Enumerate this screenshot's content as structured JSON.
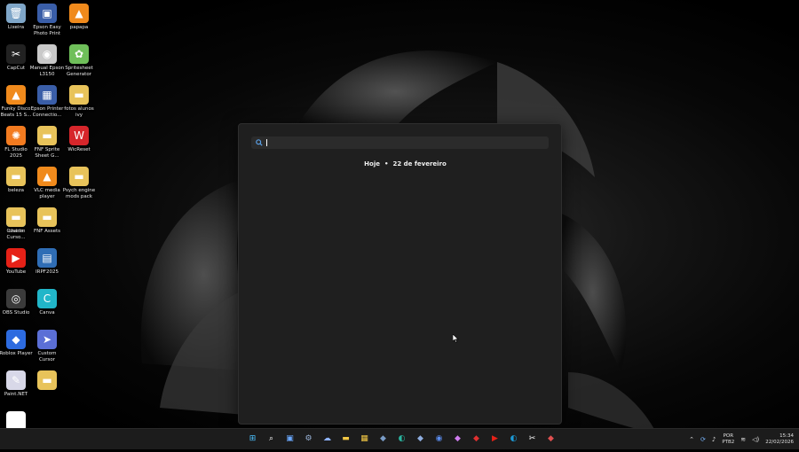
{
  "desktop": {
    "icons": [
      {
        "label": "Lixeira",
        "icon": "recycle-bin-icon",
        "color": "#7fa6c8"
      },
      {
        "label": "Epson Easy Photo Print",
        "icon": "epson-photo-icon",
        "color": "#3a5ea8"
      },
      {
        "label": "papapa",
        "icon": "vlc-icon",
        "color": "#f08a1c"
      },
      {
        "label": "CapCut",
        "icon": "capcut-icon",
        "color": "#222222"
      },
      {
        "label": "Manual Epson L3150",
        "icon": "manual-icon",
        "color": "#c9c9c9"
      },
      {
        "label": "Spritesheet Generator",
        "icon": "spritesheet-icon",
        "color": "#6fbf5a"
      },
      {
        "label": "Funky Disco Beats 15 S...",
        "icon": "vlc-icon",
        "color": "#f08a1c"
      },
      {
        "label": "Epson Printer Connectio...",
        "icon": "epson-printer-icon",
        "color": "#3a5ea8"
      },
      {
        "label": "fotos alunos ivy",
        "icon": "folder-icon",
        "color": "#e8c35a"
      },
      {
        "label": "FL Studio 2025",
        "icon": "fl-studio-icon",
        "color": "#f37b20"
      },
      {
        "label": "FNF Sprite Sheet G...",
        "icon": "folder-icon",
        "color": "#e8c35a"
      },
      {
        "label": "WicReset",
        "icon": "wicreset-icon",
        "color": "#d6262b"
      },
      {
        "label": "beleza",
        "icon": "folder-icon",
        "color": "#e8c35a"
      },
      {
        "label": "VLC media player",
        "icon": "vlc-icon",
        "color": "#f08a1c"
      },
      {
        "label": "Psych engine mods pack",
        "icon": "folder-icon",
        "color": "#e8c35a"
      },
      {
        "label": "Custom Curso...",
        "icon": "edge-icon",
        "color": "#1c9ad6"
      },
      {
        "label": "charts",
        "icon": "folder-icon",
        "color": "#e8c35a"
      },
      {
        "label": "FNF Assets",
        "icon": "folder-icon",
        "color": "#e8c35a"
      },
      {
        "label": "YouTube",
        "icon": "youtube-icon",
        "color": "#e62117"
      },
      {
        "label": "IRPF2025",
        "icon": "irpf-icon",
        "color": "#2f6db5"
      },
      {
        "label": "OBS Studio",
        "icon": "obs-icon",
        "color": "#3b3b3b"
      },
      {
        "label": "Canva",
        "icon": "canva-icon",
        "color": "#21b6c9"
      },
      {
        "label": "Roblox Player",
        "icon": "roblox-icon",
        "color": "#2d6be0"
      },
      {
        "label": "Custom Cursor",
        "icon": "cursor-app-icon",
        "color": "#5b6fd6"
      },
      {
        "label": "Paint.NET",
        "icon": "paintnet-icon",
        "color": "#d8d8e8"
      },
      {
        "label": "",
        "icon": "folder-icon",
        "color": "#e8c35a"
      },
      {
        "label": "",
        "icon": "roblox-studio-icon",
        "color": "#ffffff"
      }
    ]
  },
  "search": {
    "value": "",
    "placeholder": "",
    "today_label": "Hoje",
    "date_label": "22 de fevereiro"
  },
  "taskbar": {
    "apps": [
      {
        "name": "start-button",
        "icon": "windows-icon",
        "color": "#4cc2ff"
      },
      {
        "name": "search-button",
        "icon": "search-icon",
        "color": "#ffffff"
      },
      {
        "name": "task-view-button",
        "icon": "task-view-icon",
        "color": "#6aa8ff"
      },
      {
        "name": "settings-button",
        "icon": "gear-icon",
        "color": "#9ab4d8"
      },
      {
        "name": "copilot-button",
        "icon": "copilot-icon",
        "color": "#8fb4ff"
      },
      {
        "name": "file-explorer-button",
        "icon": "folder-icon",
        "color": "#f2c744"
      },
      {
        "name": "store-button",
        "icon": "store-icon",
        "color": "#f2c744"
      },
      {
        "name": "app-button-1",
        "icon": "app-icon",
        "color": "#7a9cc6"
      },
      {
        "name": "edge-beta-button",
        "icon": "edge-icon",
        "color": "#2ab5a0"
      },
      {
        "name": "app-button-2",
        "icon": "app-icon",
        "color": "#8faee0"
      },
      {
        "name": "chrome-button",
        "icon": "chrome-icon",
        "color": "#5b8def"
      },
      {
        "name": "app-button-3",
        "icon": "app-icon",
        "color": "#d07cf0"
      },
      {
        "name": "app-button-4",
        "icon": "app-icon",
        "color": "#e03030"
      },
      {
        "name": "youtube-button",
        "icon": "youtube-icon",
        "color": "#e62117"
      },
      {
        "name": "edge-button",
        "icon": "edge-icon",
        "color": "#1c9ad6"
      },
      {
        "name": "capcut-button",
        "icon": "capcut-icon",
        "color": "#ffffff"
      },
      {
        "name": "app-button-5",
        "icon": "app-icon",
        "color": "#e05050"
      }
    ],
    "tray": {
      "lang_line1": "POR",
      "lang_line2": "PTB2",
      "time": "15:34",
      "date": "22/02/2026"
    }
  }
}
